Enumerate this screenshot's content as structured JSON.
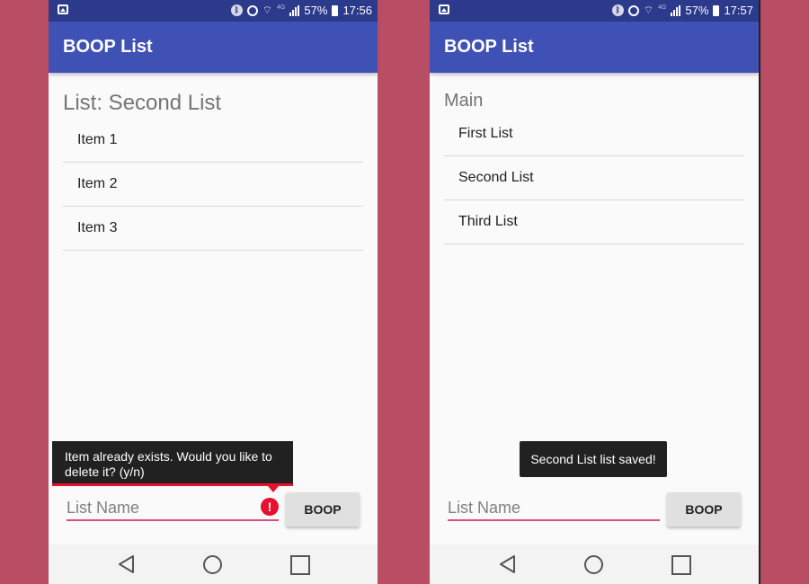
{
  "screens": {
    "left": {
      "status_bar": {
        "battery": "57%",
        "time": "17:56"
      },
      "app_bar": {
        "title": "BOOP List"
      },
      "heading": "List: Second List",
      "items": [
        "Item 1",
        "Item 2",
        "Item 3"
      ],
      "error_popup": {
        "message": "Item already exists. Would you like to delete it? (y/n)"
      },
      "input": {
        "placeholder": "List Name",
        "value": ""
      },
      "button_label": "BOOP"
    },
    "right": {
      "status_bar": {
        "battery": "57%",
        "time": "17:57"
      },
      "app_bar": {
        "title": "BOOP List"
      },
      "heading": "Main",
      "items": [
        "First List",
        "Second List",
        "Third List"
      ],
      "toast": "Second List list saved!",
      "input": {
        "placeholder": "List Name",
        "value": ""
      },
      "button_label": "BOOP"
    }
  },
  "colors": {
    "background": "#b84d63",
    "status_bar": "#2c3a8c",
    "app_bar": "#3f51b5",
    "accent": "#e04c7c",
    "error": "#e8112d"
  },
  "icons": {
    "status_bar": [
      "gallery-icon",
      "bluetooth-icon",
      "alarm-icon",
      "wifi-icon",
      "signal-icon",
      "battery-icon"
    ],
    "nav_bar": [
      "back-icon",
      "home-icon",
      "recents-icon"
    ],
    "input": [
      "error-icon"
    ]
  }
}
